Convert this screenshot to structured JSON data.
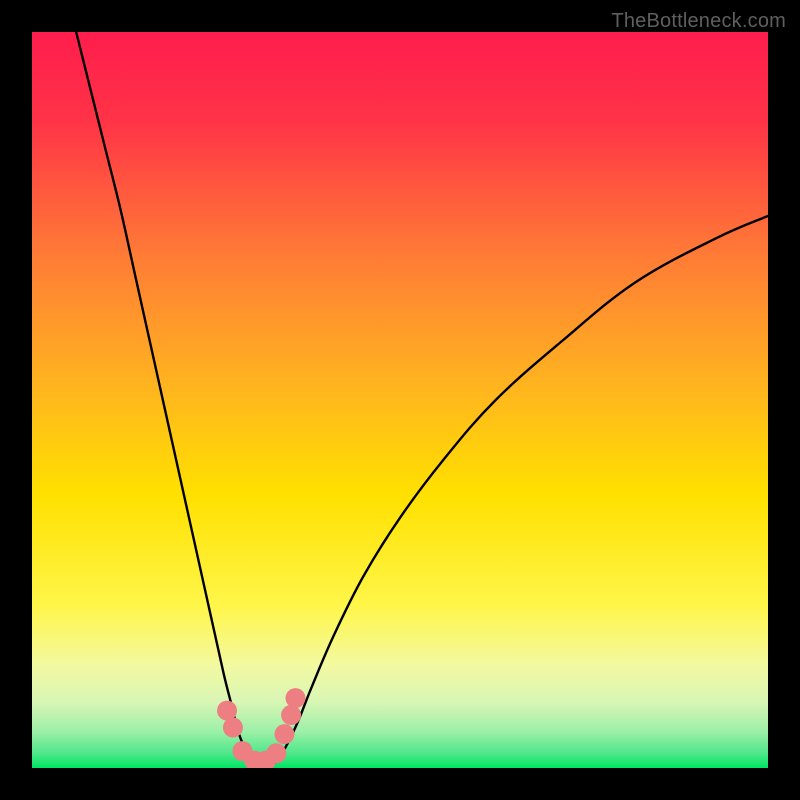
{
  "watermark": "TheBottleneck.com",
  "chart_data": {
    "type": "line",
    "title": "",
    "xlabel": "",
    "ylabel": "",
    "x_range": [
      0,
      100
    ],
    "y_range": [
      0,
      100
    ],
    "grid": false,
    "legend": false,
    "background_gradient_top_color": "#ff1d4d",
    "background_gradient_mid_color": "#ffe100",
    "background_gradient_bottom_color": "#00e562",
    "series": [
      {
        "name": "curve-left",
        "x": [
          6,
          8,
          10,
          12,
          14,
          16,
          18,
          20,
          22,
          24,
          26,
          27,
          28,
          29,
          30
        ],
        "y": [
          100,
          92,
          84,
          76,
          67,
          58,
          49,
          40,
          31,
          22,
          13,
          9,
          5,
          2.5,
          0.7
        ]
      },
      {
        "name": "curve-right",
        "x": [
          33,
          34,
          36,
          38,
          41,
          45,
          50,
          56,
          63,
          72,
          82,
          93,
          100
        ],
        "y": [
          0.7,
          2,
          6,
          11,
          18,
          26,
          34,
          42,
          50,
          58,
          66,
          72,
          75
        ]
      },
      {
        "name": "bottom-markers",
        "x": [
          26.5,
          27.3,
          28.6,
          30.2,
          31.8,
          33.2,
          34.3,
          35.2,
          35.8
        ],
        "y": [
          7.8,
          5.5,
          2.3,
          1.0,
          1.0,
          2.0,
          4.6,
          7.2,
          9.5
        ]
      }
    ]
  }
}
